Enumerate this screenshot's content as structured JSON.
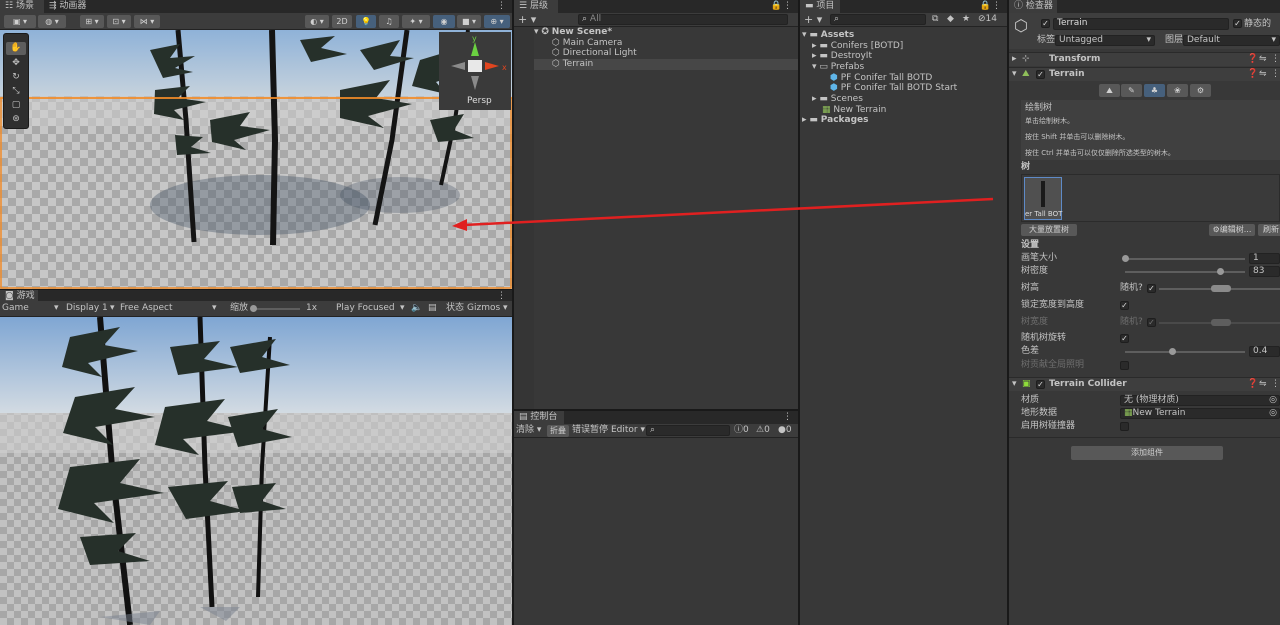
{
  "scene": {
    "tabs": [
      "场景",
      "动画器"
    ],
    "toolbar": {
      "mode_2d": "2D"
    },
    "gizmo": {
      "axis_y": "y",
      "axis_x": "x",
      "view_label": "Persp"
    }
  },
  "game": {
    "tab": "游戏",
    "game_dropdown": "Game",
    "display_dropdown": "Display 1",
    "aspect_dropdown": "Free Aspect",
    "scale_label": "缩放",
    "scale_value": "1x",
    "play_mode": "Play Focused",
    "stats_label": "状态",
    "gizmos_label": "Gizmos"
  },
  "hierarchy": {
    "tab": "层级",
    "search_placeholder": "All",
    "items": [
      {
        "label": "New Scene*"
      },
      {
        "label": "Main Camera"
      },
      {
        "label": "Directional Light"
      },
      {
        "label": "Terrain"
      }
    ]
  },
  "console": {
    "tab": "控制台",
    "clear": "清除",
    "collapse": "折叠",
    "error_pause": "错误暂停",
    "editor_dropdown": "Editor",
    "counts": {
      "info": "0",
      "warn": "0",
      "error": "0"
    }
  },
  "project": {
    "tab": "项目",
    "hidden_count": "14",
    "items": [
      {
        "label": "Assets"
      },
      {
        "label": "Conifers [BOTD]"
      },
      {
        "label": "DestroyIt"
      },
      {
        "label": "Prefabs"
      },
      {
        "label": "PF Conifer Tall BOTD"
      },
      {
        "label": "PF Conifer Tall BOTD Start"
      },
      {
        "label": "Scenes"
      },
      {
        "label": "New Terrain"
      },
      {
        "label": "Packages"
      }
    ]
  },
  "inspector": {
    "tab": "检查器",
    "object_name": "Terrain",
    "static_label": "静态的",
    "tag_label": "标签",
    "tag_value": "Untagged",
    "layer_label": "图层",
    "layer_value": "Default",
    "transform": {
      "title": "Transform"
    },
    "terrain": {
      "title": "Terrain",
      "paint_title": "绘制树",
      "help1": "单击绘制树木。",
      "help2": "按住 Shift 并单击可以删除树木。",
      "help3": "按住 Ctrl 并单击可以仅仅删除所选类型的树木。",
      "trees_label": "树",
      "tree_item_label": "er Tall BOT",
      "mass_place": "大量放置树",
      "edit_trees": "编辑树...",
      "refresh": "刷新",
      "settings_label": "设置",
      "brush_size": {
        "label": "画笔大小",
        "value": "1",
        "fraction": 0.01
      },
      "tree_density": {
        "label": "树密度",
        "value": "83",
        "fraction": 0.8
      },
      "tree_height": {
        "label": "树高",
        "random": "随机?"
      },
      "lock_width": {
        "label": "锁定宽度到高度"
      },
      "tree_width": {
        "label": "树宽度",
        "random": "随机?"
      },
      "random_rotation": {
        "label": "随机树旋转"
      },
      "color_variation": {
        "label": "色差",
        "value": "0.4",
        "fraction": 0.4
      },
      "lightmap_contribute": {
        "label": "树贡献全局照明"
      }
    },
    "collider": {
      "title": "Terrain Collider",
      "material_label": "材质",
      "material_value": "无 (物理材质)",
      "terrain_data_label": "地形数据",
      "terrain_data_value": "New Terrain",
      "tree_colliders_label": "启用树碰撞器"
    },
    "add_component": "添加组件"
  },
  "colors": {
    "accent_blue": "#46607c",
    "selection_orange": "#f28c28",
    "annotation_red": "#e02020",
    "sky_top": "#8fb2d8",
    "ground": "#bdbdbd"
  }
}
